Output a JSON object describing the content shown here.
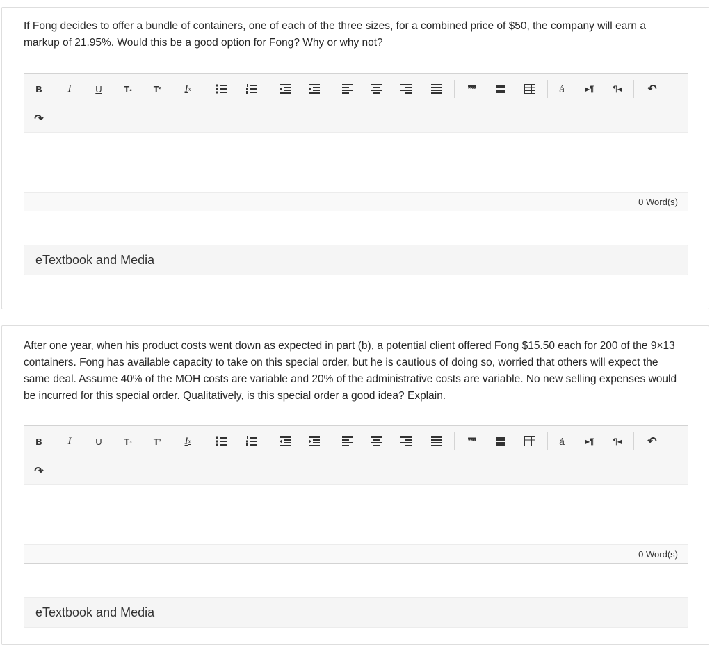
{
  "questions": [
    {
      "text": "If Fong decides to offer a bundle of containers, one of each of the three sizes, for a combined price of $50, the company will earn a markup of 21.95%. Would this be a good option for Fong? Why or why not?",
      "word_count": "0 Word(s)",
      "etextbook_label": "eTextbook and Media"
    },
    {
      "text": "After one year, when his product costs went down as expected in part (b), a potential client offered Fong $15.50 each for 200 of the 9×13 containers. Fong has available capacity to take on this special order, but he is cautious of doing so, worried that others will expect the same deal. Assume 40% of the MOH costs are variable and 20% of the administrative costs are variable. No new selling expenses would be incurred for this special order. Qualitatively, is this special order a good idea? Explain.",
      "word_count": "0 Word(s)",
      "etextbook_label": "eTextbook and Media"
    }
  ],
  "toolbar": {
    "bold_label": "B",
    "italic_label": "I",
    "underline_label": "U",
    "subscript_label": "T",
    "subscript_mark": "₂",
    "superscript_label": "T",
    "superscript_mark": "²",
    "clear_format_label": "I",
    "clear_format_mark": "x",
    "blockquote_label": "❞❞",
    "special_char_label": "á",
    "ltr_label": "▸¶",
    "rtl_label": "¶◂",
    "undo_label": "↶",
    "redo_label": "↷"
  }
}
